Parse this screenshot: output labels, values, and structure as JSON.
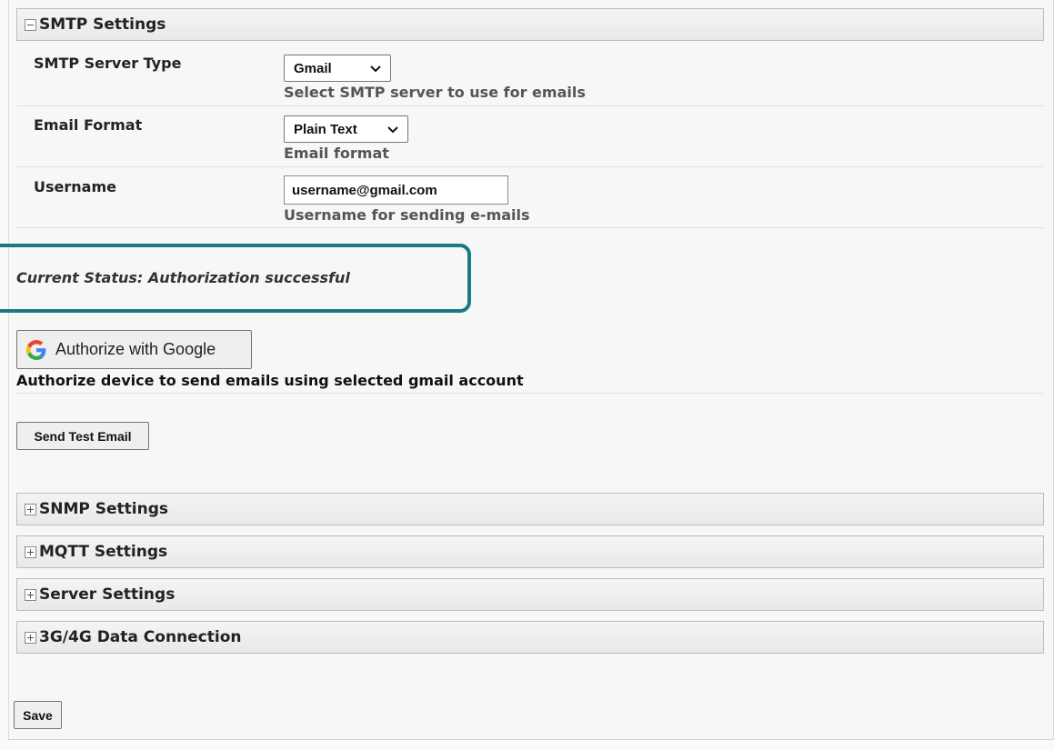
{
  "smtp": {
    "header": "SMTP Settings",
    "server_type": {
      "label": "SMTP Server Type",
      "value": "Gmail",
      "help": "Select SMTP server to use for emails"
    },
    "email_format": {
      "label": "Email Format",
      "value": "Plain Text",
      "help": "Email format"
    },
    "username": {
      "label": "Username",
      "value": "username@gmail.com",
      "help": "Username for sending e-mails"
    },
    "status": "Current Status: Authorization successful",
    "authorize_button": "Authorize with Google",
    "authorize_desc": "Authorize device to send emails using selected gmail account",
    "test_button": "Send Test Email"
  },
  "sections": [
    {
      "label": "SNMP Settings"
    },
    {
      "label": "MQTT Settings"
    },
    {
      "label": "Server Settings"
    },
    {
      "label": "3G/4G Data Connection"
    }
  ],
  "save_label": "Save",
  "colors": {
    "highlight": "#197a83",
    "google_blue": "#4285F4",
    "google_red": "#EA4335",
    "google_yellow": "#FBBC05",
    "google_green": "#34A853"
  },
  "icons": {
    "expanded": "minus-box-icon",
    "collapsed": "plus-box-icon",
    "select": "chevron-down-icon",
    "google": "google-g-icon"
  }
}
